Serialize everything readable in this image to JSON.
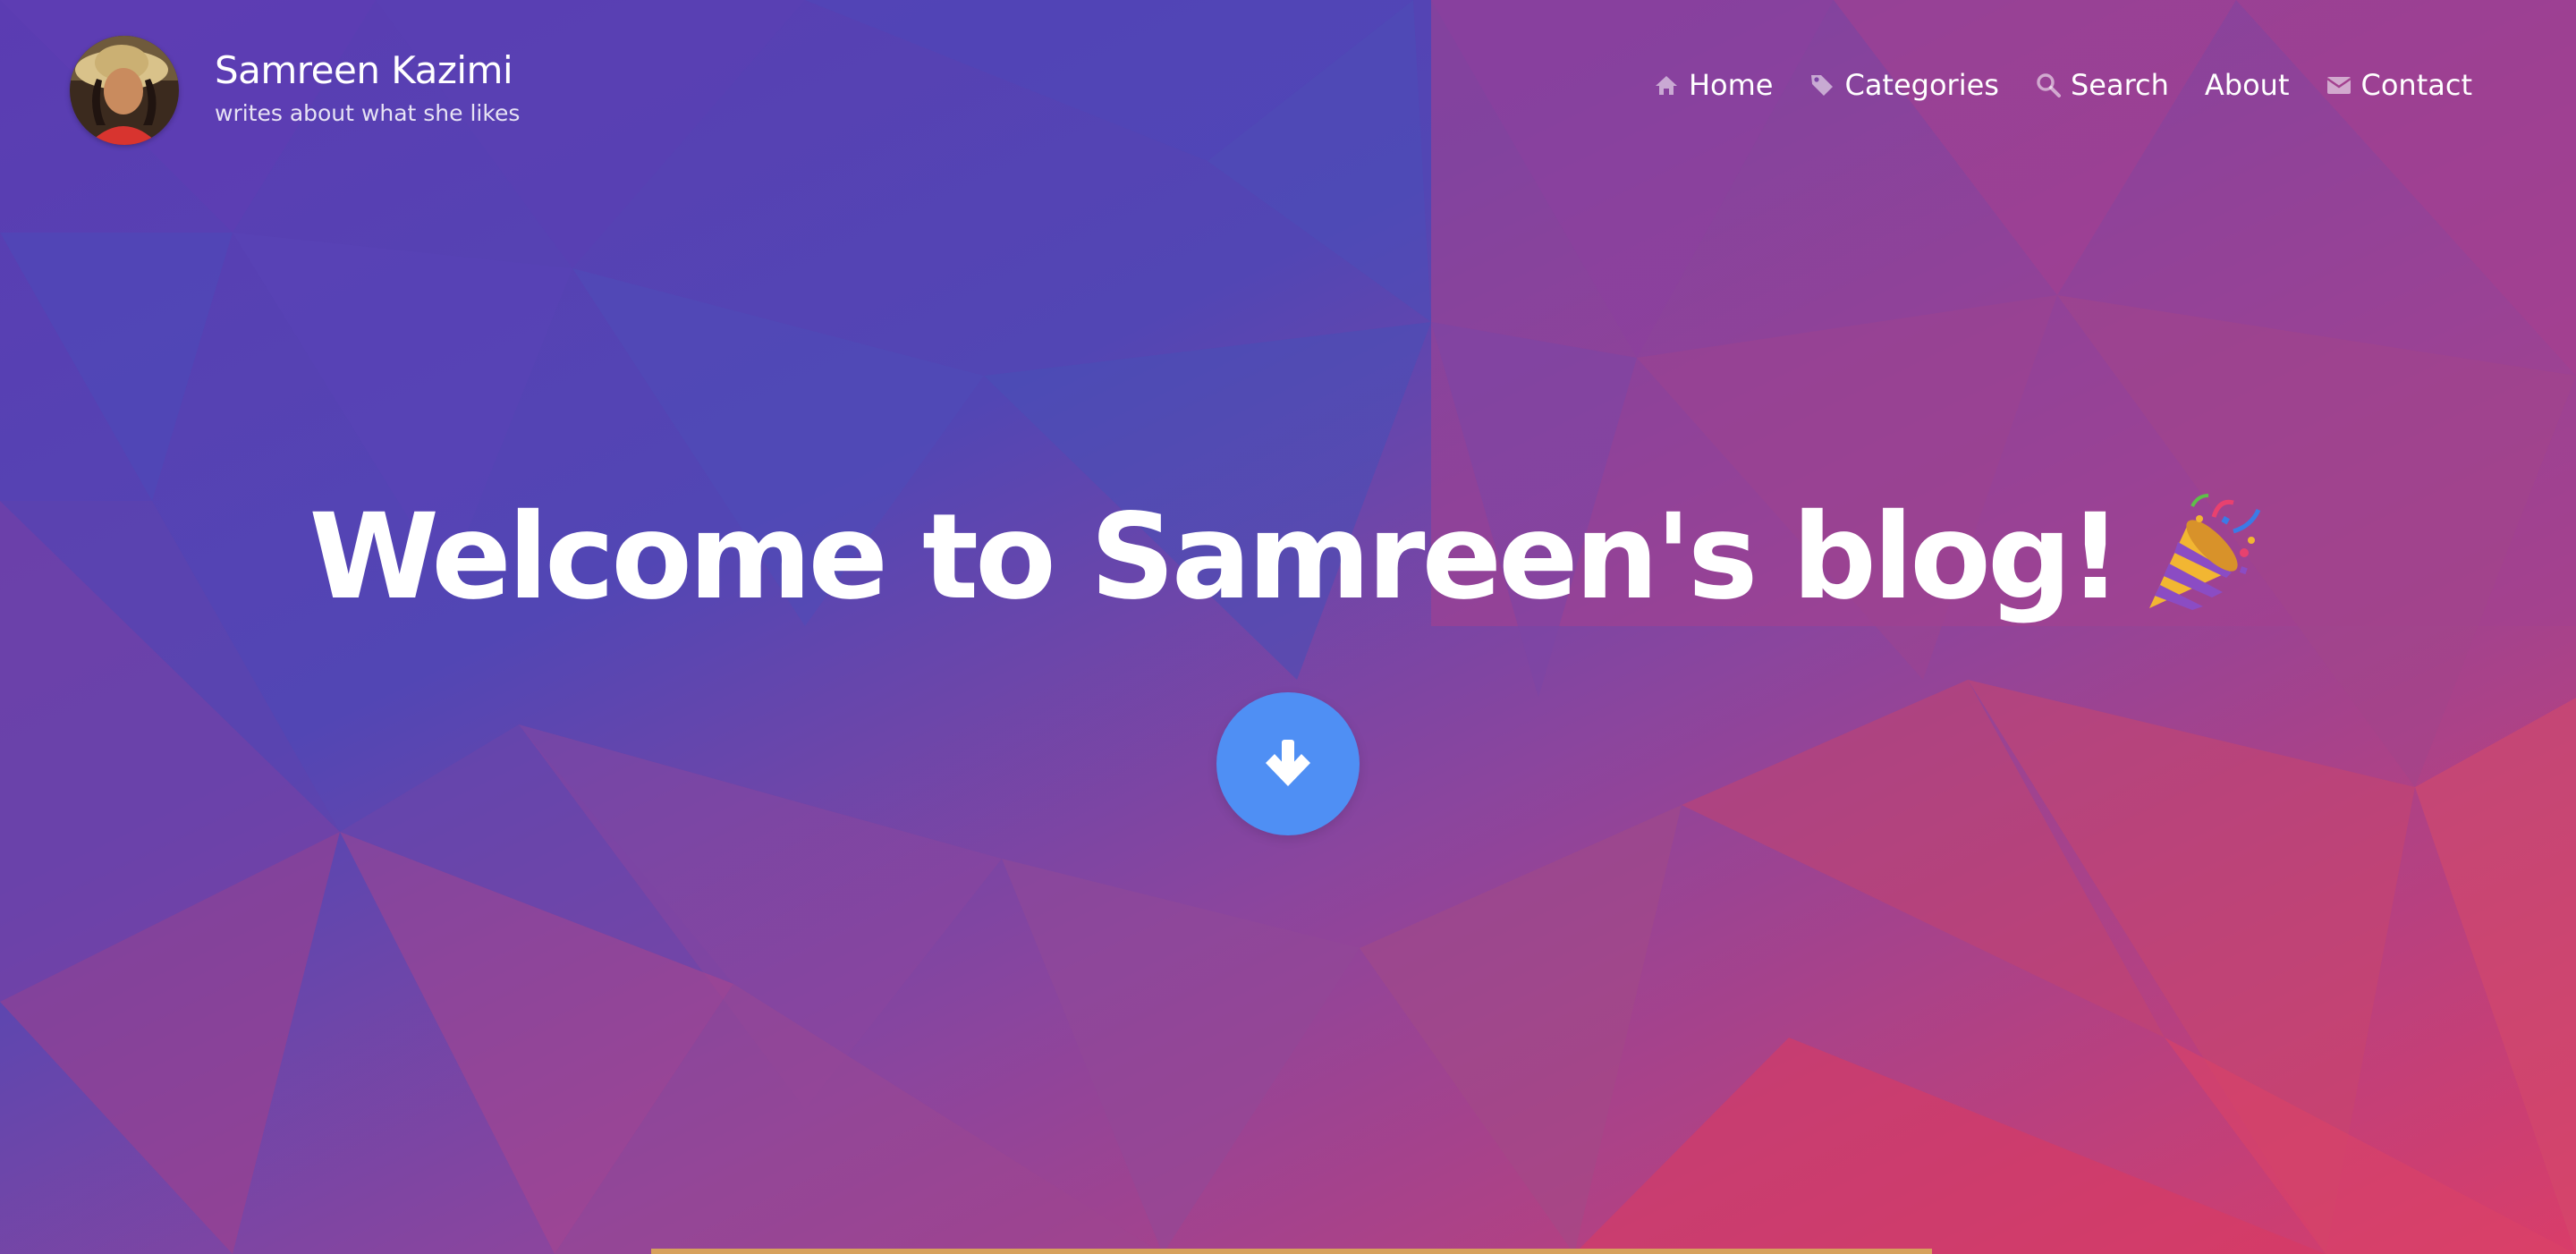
{
  "header": {
    "site_title": "Samreen Kazimi",
    "tagline": "writes about what she likes",
    "avatar_alt": "Samreen Kazimi avatar"
  },
  "nav": {
    "items": [
      {
        "label": "Home",
        "icon": "home-icon"
      },
      {
        "label": "Categories",
        "icon": "tag-icon"
      },
      {
        "label": "Search",
        "icon": "search-icon"
      },
      {
        "label": "About",
        "icon": ""
      },
      {
        "label": "Contact",
        "icon": "envelope-icon"
      }
    ]
  },
  "hero": {
    "title": "Welcome to Samreen's blog!",
    "emoji_icon": "party-popper-icon",
    "scroll_icon": "arrow-down-icon"
  },
  "colors": {
    "bg_purple": "#5b3fb3",
    "bg_blue": "#4a55b6",
    "bg_magenta": "#a23c8e",
    "bg_pink": "#d63a66",
    "button_blue": "#4f8ff4",
    "text_white": "#ffffff"
  }
}
